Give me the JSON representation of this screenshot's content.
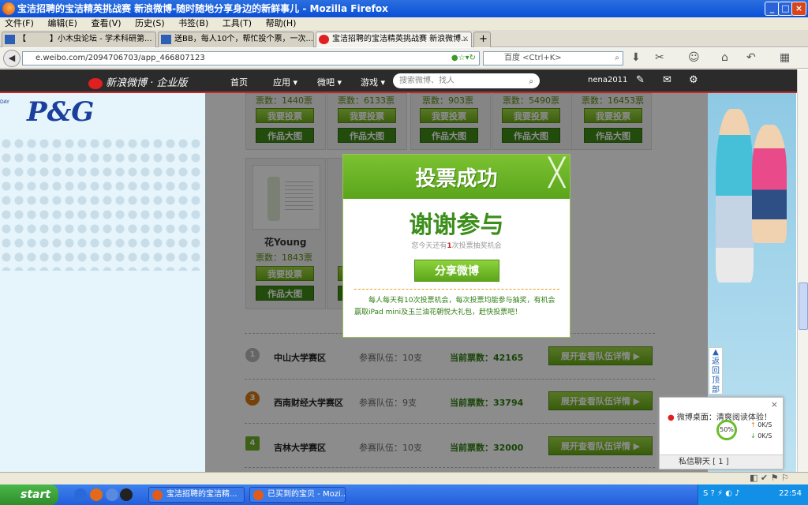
{
  "window": {
    "title": "宝洁招聘的宝洁精英挑战赛 新浪微博-随时随地分享身边的新鲜事儿 - Mozilla Firefox",
    "min": "_",
    "max": "□",
    "close": "×"
  },
  "menubar": [
    "文件(F)",
    "编辑(E)",
    "查看(V)",
    "历史(S)",
    "书签(B)",
    "工具(T)",
    "帮助(H)"
  ],
  "tabs": [
    {
      "label": "【　　　】小木虫论坛 - 学术科研第..."
    },
    {
      "label": "送BB，每人10个，帮忙投个票，一次..."
    },
    {
      "label": "宝洁招聘的宝洁精英挑战赛 新浪微博..."
    }
  ],
  "newtab": "+",
  "navbar": {
    "url": "e.weibo.com/2094706703/app_466807123",
    "search_placeholder": "百度 <Ctrl+K>"
  },
  "weibo": {
    "logo": "新浪微博 · 企业版",
    "nav": [
      "首页",
      "应用 ▾",
      "微吧 ▾",
      "游戏 ▾"
    ],
    "search_placeholder": "搜索微博、找人",
    "username": "nena2011"
  },
  "brand": {
    "logo": "P&G",
    "tag": "DAY"
  },
  "cards_row1": [
    {
      "votes": "票数：1440票"
    },
    {
      "votes": "票数：6133票"
    },
    {
      "votes": "票数：903票"
    },
    {
      "votes": "票数：5490票"
    },
    {
      "votes": "票数：16453票"
    }
  ],
  "cards_row2": [
    {
      "name": "花Young",
      "votes": "票数：1843票"
    }
  ],
  "vote_btn": "我要投票",
  "view_btn": "作品大图",
  "schools": [
    {
      "rank": "1",
      "name": "中山大学赛区",
      "teams": "参赛队伍：10支",
      "current": "当前票数：42165",
      "detail": "展开查看队伍详情 ▶"
    },
    {
      "rank": "3",
      "name": "西南财经大学赛区",
      "teams": "参赛队伍：9支",
      "current": "当前票数：33794",
      "detail": "展开查看队伍详情 ▶"
    },
    {
      "rank": "4",
      "name": "吉林大学赛区",
      "teams": "参赛队伍：10支",
      "current": "当前票数：32000",
      "detail": "展开查看队伍详情 ▶"
    }
  ],
  "modal": {
    "title": "投票成功",
    "thanks": "谢谢参与",
    "remain_pre": "您今天还有",
    "remain_num": "1",
    "remain_post": "次投票抽奖机会",
    "share": "分享微博",
    "note": "每人每天有10次投票机会，每次投票均能参与抽奖，有机会赢取iPad mini及玉兰油花朝悦大礼包，赶快投票吧！"
  },
  "backtop": "返回顶部",
  "notify": {
    "text": "微博桌面：清爽阅读体验！",
    "percent": "50%",
    "up": "0K/S",
    "down": "0K/S",
    "chat": "私信聊天 [ 1 ]"
  },
  "taskbar": {
    "start": "start",
    "tasks": [
      "宝洁招聘的宝洁精...",
      "已买到的宝贝 - Mozi..."
    ],
    "clock": "22:54"
  }
}
